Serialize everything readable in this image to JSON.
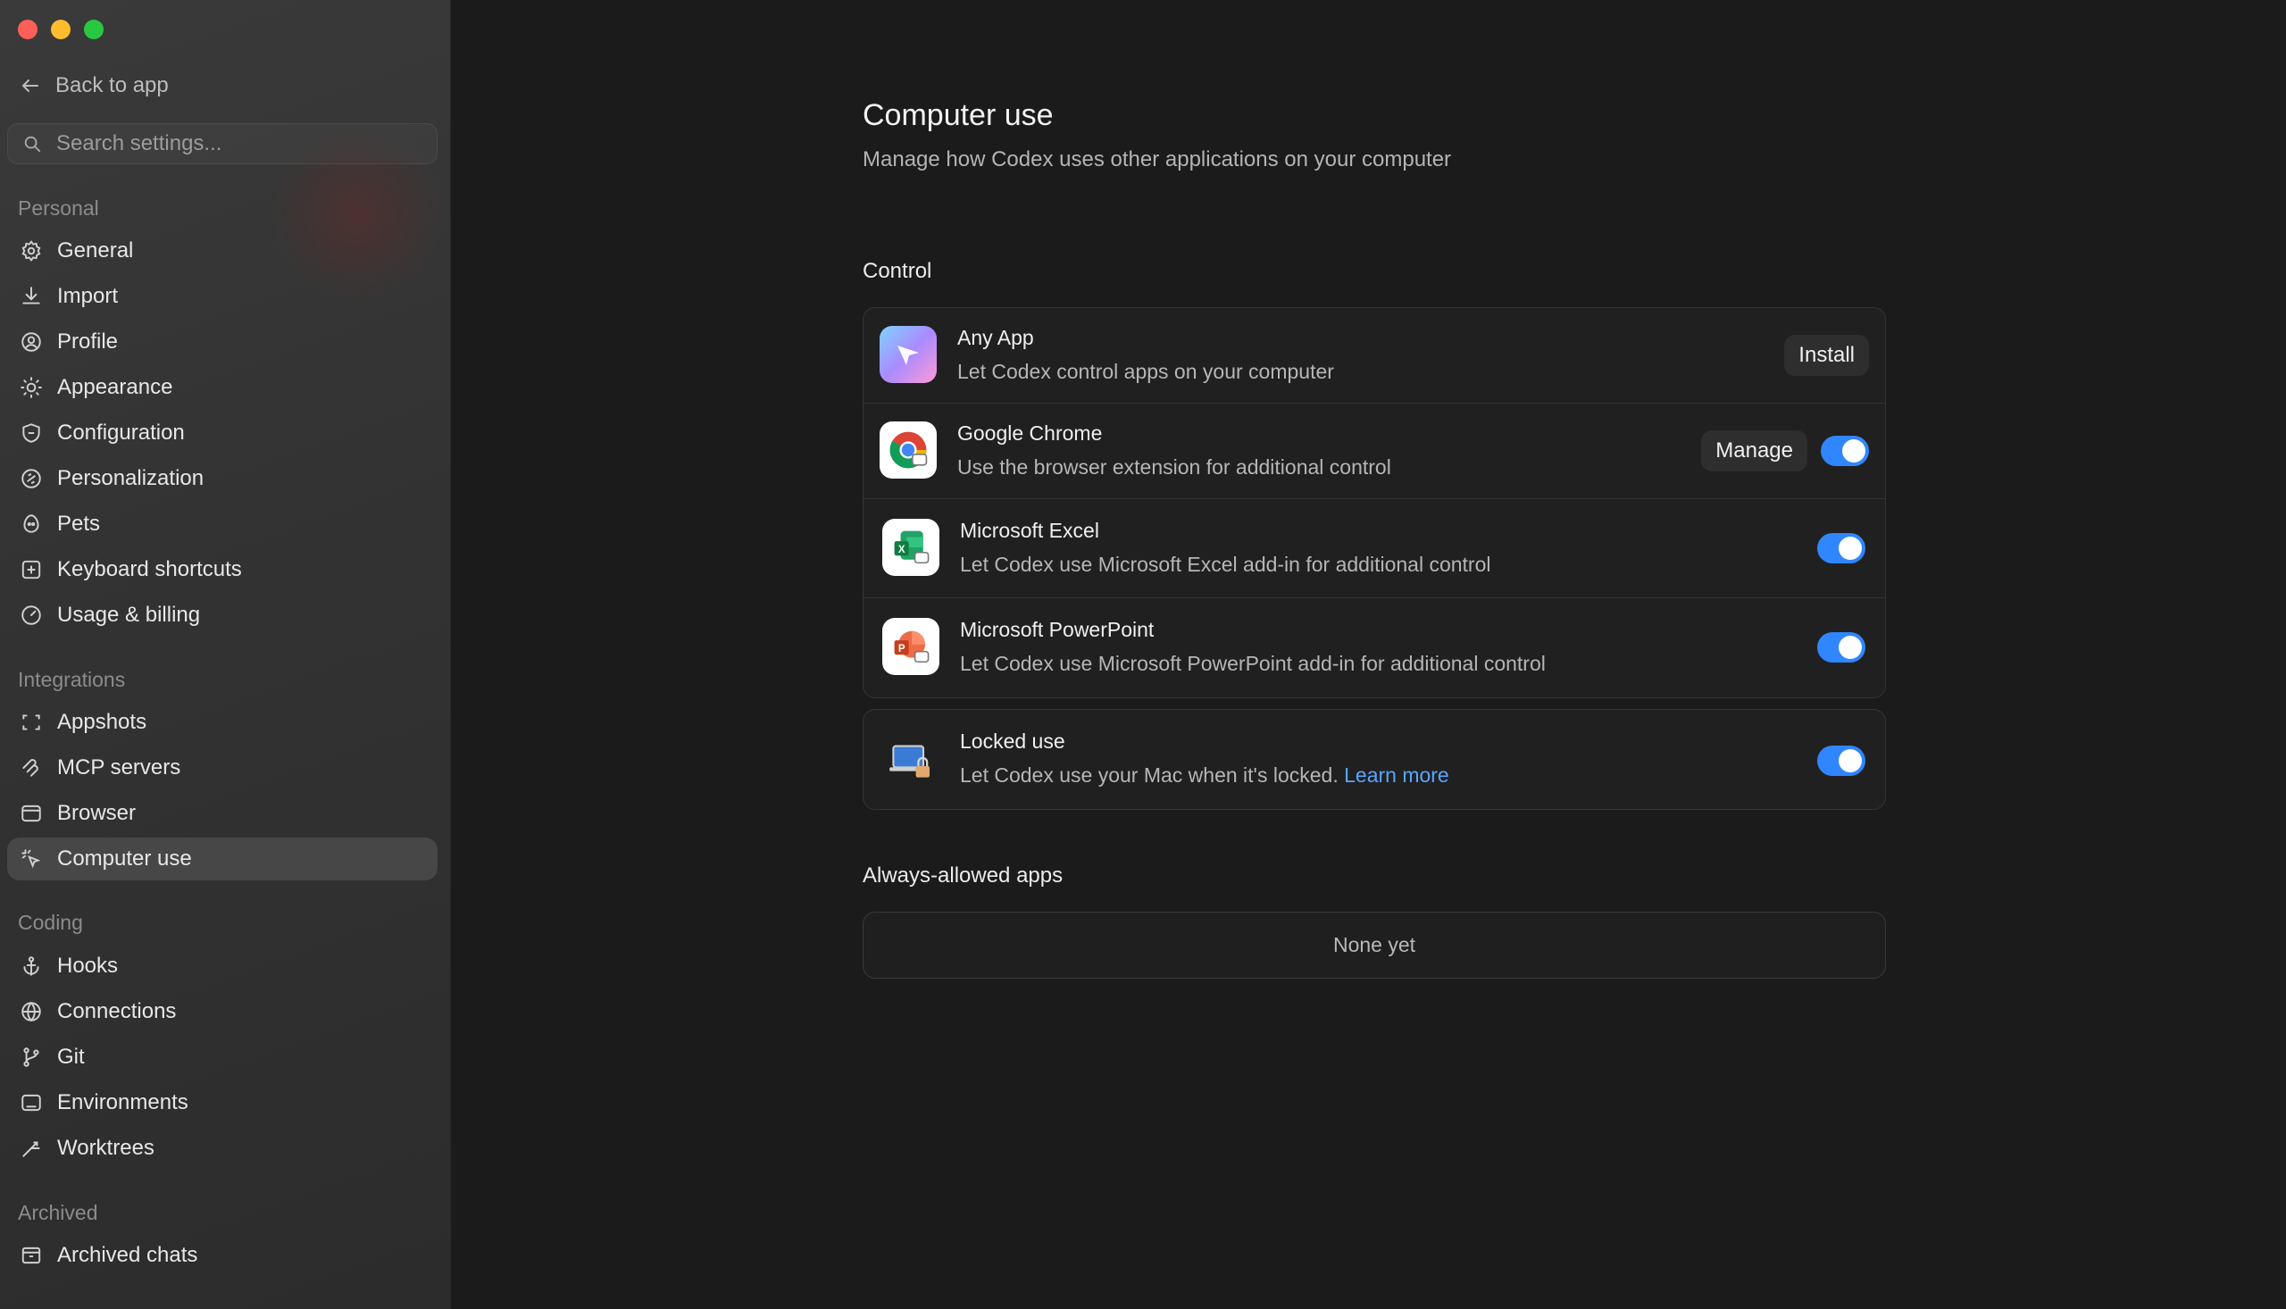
{
  "window": {
    "traffic_lights": [
      "close",
      "minimize",
      "zoom"
    ]
  },
  "sidebar": {
    "back_label": "Back to app",
    "search_placeholder": "Search settings...",
    "sections": [
      {
        "label": "Personal",
        "items": [
          {
            "label": "General",
            "icon": "gear-icon"
          },
          {
            "label": "Import",
            "icon": "download-icon"
          },
          {
            "label": "Profile",
            "icon": "user-circle-icon"
          },
          {
            "label": "Appearance",
            "icon": "sun-icon"
          },
          {
            "label": "Configuration",
            "icon": "shield-icon"
          },
          {
            "label": "Personalization",
            "icon": "personalization-icon"
          },
          {
            "label": "Pets",
            "icon": "egg-icon"
          },
          {
            "label": "Keyboard shortcuts",
            "icon": "keyboard-icon"
          },
          {
            "label": "Usage & billing",
            "icon": "gauge-icon"
          }
        ]
      },
      {
        "label": "Integrations",
        "items": [
          {
            "label": "Appshots",
            "icon": "screenshot-frame-icon"
          },
          {
            "label": "MCP servers",
            "icon": "mcp-icon"
          },
          {
            "label": "Browser",
            "icon": "browser-window-icon"
          },
          {
            "label": "Computer use",
            "icon": "cursor-click-icon",
            "active": true
          }
        ]
      },
      {
        "label": "Coding",
        "items": [
          {
            "label": "Hooks",
            "icon": "anchor-icon"
          },
          {
            "label": "Connections",
            "icon": "globe-icon"
          },
          {
            "label": "Git",
            "icon": "git-branch-icon"
          },
          {
            "label": "Environments",
            "icon": "laptop-icon"
          },
          {
            "label": "Worktrees",
            "icon": "worktree-icon"
          }
        ]
      },
      {
        "label": "Archived",
        "items": [
          {
            "label": "Archived chats",
            "icon": "archive-box-icon"
          }
        ]
      }
    ]
  },
  "main": {
    "title": "Computer use",
    "subtitle": "Manage how Codex uses other applications on your computer",
    "control_label": "Control",
    "control_rows": [
      {
        "title": "Any App",
        "description": "Let Codex control apps on your computer",
        "icon": "codex-cursor-icon",
        "button": "Install"
      },
      {
        "title": "Google Chrome",
        "description": "Use the browser extension for additional control",
        "icon": "chrome-icon",
        "button": "Manage",
        "toggle": true
      },
      {
        "title": "Microsoft Excel",
        "description": "Let Codex use Microsoft Excel add-in for additional control",
        "icon": "excel-icon",
        "toggle": true
      },
      {
        "title": "Microsoft PowerPoint",
        "description": "Let Codex use Microsoft PowerPoint add-in for additional control",
        "icon": "powerpoint-icon",
        "toggle": true
      }
    ],
    "locked": {
      "title": "Locked use",
      "description": "Let Codex use your Mac when it's locked.",
      "link": "Learn more",
      "icon": "locked-laptop-icon",
      "toggle": true
    },
    "always_allowed_label": "Always-allowed apps",
    "always_allowed_empty": "None yet",
    "colors": {
      "toggle_on": "#2f86ff",
      "link": "#5aa5ff"
    }
  }
}
